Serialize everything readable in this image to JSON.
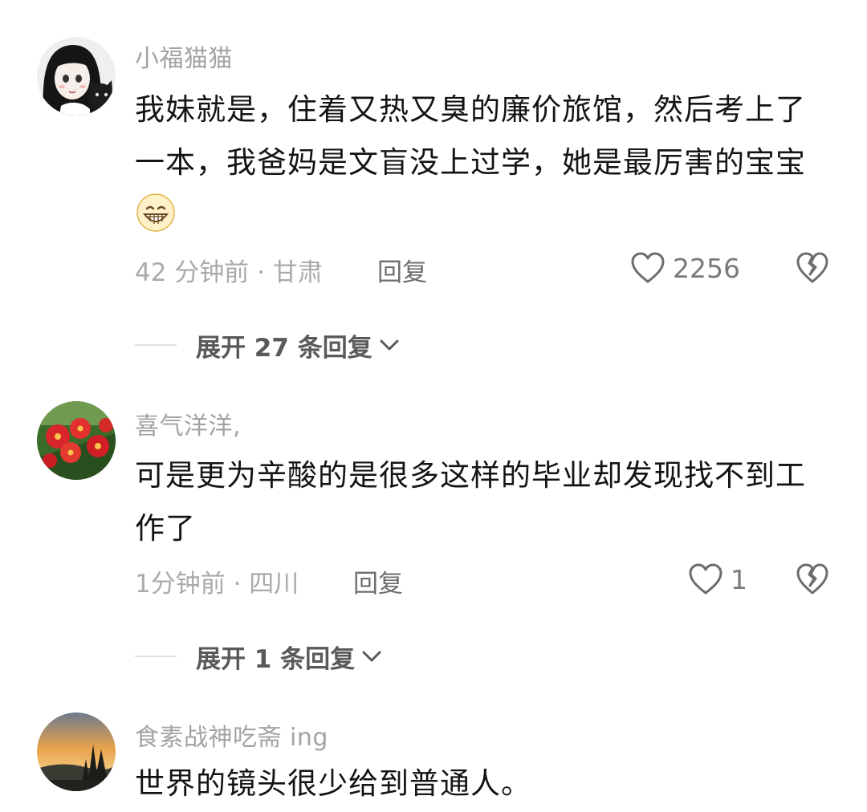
{
  "comments": [
    {
      "username": "小福猫猫",
      "text": "我妹就是，住着又热又臭的廉价旅馆，然后考上了一本，我爸妈是文盲没上过学，她是最厉害的宝宝",
      "time": "42 分钟前 · 甘肃",
      "reply_label": "回复",
      "like_count": "2256",
      "expand_label": "展开 27 条回复",
      "emoji": "grinning-face-icon",
      "avatar": "anime-girl-with-cat"
    },
    {
      "username": "喜气洋洋,",
      "text": "可是更为辛酸的是很多这样的毕业却发现找不到工作了",
      "time": "1分钟前 · 四川",
      "reply_label": "回复",
      "like_count": "1",
      "expand_label": "展开 1 条回复",
      "avatar": "red-flowers"
    },
    {
      "username": "食素战神吃斋 ing",
      "text": "世界的镜头很少给到普通人。",
      "avatar": "sunset-landscape"
    }
  ],
  "colors": {
    "username": "#a3a3a3",
    "text": "#141414",
    "meta": "#aaaaaa",
    "expand": "#5a5a5a"
  }
}
